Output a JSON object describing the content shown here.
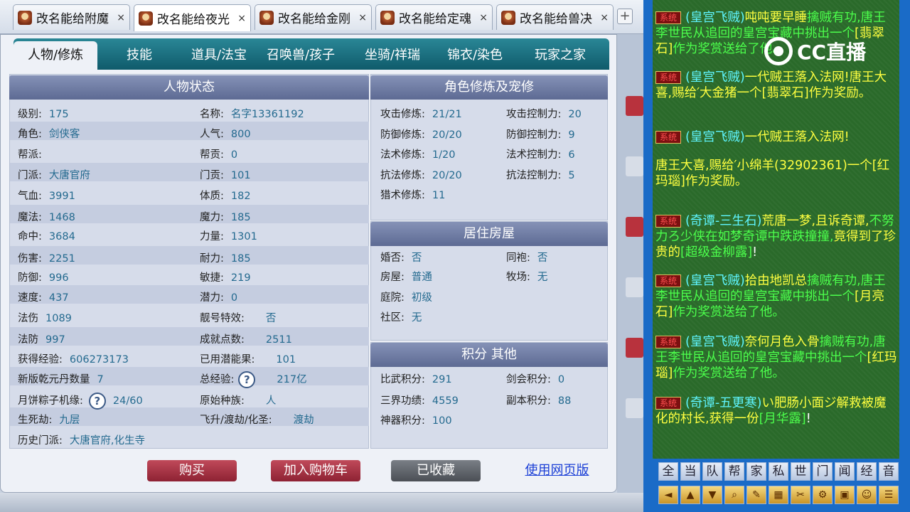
{
  "browser_tabs": [
    {
      "label": "改名能给附魔",
      "close": "×"
    },
    {
      "label": "改名能给夜光",
      "close": "×"
    },
    {
      "label": "改名能给金刚",
      "close": "×"
    },
    {
      "label": "改名能给定魂",
      "close": "×"
    },
    {
      "label": "改名能给兽决",
      "close": "×"
    }
  ],
  "new_tab": "+",
  "nav_tabs": [
    "人物/修炼",
    "技能",
    "道具/法宝",
    "召唤兽/孩子",
    "坐骑/祥瑞",
    "锦衣/染色",
    "玩家之家"
  ],
  "status": {
    "title": "人物状态",
    "left": [
      {
        "l": "级别:",
        "v": "175"
      },
      {
        "l": "角色:",
        "v": "剑侠客"
      },
      {
        "l": "帮派:",
        "v": ""
      },
      {
        "l": "门派:",
        "v": "大唐官府"
      },
      {
        "l": "气血:",
        "v": "3991"
      },
      {
        "l": "魔法:",
        "v": "1468"
      },
      {
        "l": "命中:",
        "v": "3684"
      },
      {
        "l": "伤害:",
        "v": "2251"
      },
      {
        "l": "防御:",
        "v": "996"
      },
      {
        "l": "速度:",
        "v": "437"
      },
      {
        "l": "法伤",
        "v": "1089"
      },
      {
        "l": "法防",
        "v": "997"
      },
      {
        "l": "获得经验:",
        "v": "606273173"
      },
      {
        "l": "新版乾元丹数量",
        "v": "7"
      },
      {
        "l": "月饼粽子机缘:",
        "v": "24/60"
      },
      {
        "l": "生死劫:",
        "v": "九层"
      },
      {
        "l": "历史门派:",
        "v": "大唐官府,化生寺"
      }
    ],
    "right": [
      {
        "l": "名称:",
        "v": "名字13361192"
      },
      {
        "l": "人气:",
        "v": "800"
      },
      {
        "l": "帮贡:",
        "v": "0"
      },
      {
        "l": "门贡:",
        "v": "101"
      },
      {
        "l": "体质:",
        "v": "182"
      },
      {
        "l": "魔力:",
        "v": "185"
      },
      {
        "l": "力量:",
        "v": "1301"
      },
      {
        "l": "耐力:",
        "v": "185"
      },
      {
        "l": "敏捷:",
        "v": "219"
      },
      {
        "l": "潜力:",
        "v": "0"
      },
      {
        "l": "靓号特效:",
        "v": "否"
      },
      {
        "l": "成就点数:",
        "v": "2511"
      },
      {
        "l": "已用潜能果:",
        "v": "101"
      },
      {
        "l": "总经验:",
        "v": "217亿"
      },
      {
        "l": "原始种族:",
        "v": "人"
      },
      {
        "l": "飞升/渡劫/化圣:",
        "v": "渡劫"
      }
    ],
    "help": "?"
  },
  "cultivation": {
    "title": "角色修炼及宠修",
    "left": [
      {
        "l": "攻击修炼:",
        "v": "21/21"
      },
      {
        "l": "防御修炼:",
        "v": "20/20"
      },
      {
        "l": "法术修炼:",
        "v": "1/20"
      },
      {
        "l": "抗法修炼:",
        "v": "20/20"
      },
      {
        "l": "猎术修炼:",
        "v": "11"
      }
    ],
    "right": [
      {
        "l": "攻击控制力:",
        "v": "20"
      },
      {
        "l": "防御控制力:",
        "v": "9"
      },
      {
        "l": "法术控制力:",
        "v": "6"
      },
      {
        "l": "抗法控制力:",
        "v": "5"
      }
    ]
  },
  "housing": {
    "title": "居住房屋",
    "left": [
      {
        "l": "婚否:",
        "v": "否"
      },
      {
        "l": "房屋:",
        "v": "普通"
      },
      {
        "l": "庭院:",
        "v": "初级"
      },
      {
        "l": "社区:",
        "v": "无"
      }
    ],
    "right": [
      {
        "l": "同袍:",
        "v": "否"
      },
      {
        "l": "牧场:",
        "v": "无"
      }
    ]
  },
  "points": {
    "title": "积分 其他",
    "left": [
      {
        "l": "比武积分:",
        "v": "291"
      },
      {
        "l": "三界功绩:",
        "v": "4559"
      },
      {
        "l": "神器积分:",
        "v": "100"
      }
    ],
    "right": [
      {
        "l": "剑会积分:",
        "v": "0"
      },
      {
        "l": "副本积分:",
        "v": "88"
      }
    ]
  },
  "actions": {
    "buy": "购买",
    "add_cart": "加入购物车",
    "favorited": "已收藏",
    "web": "使用网页版"
  },
  "chat": {
    "tag": "系统",
    "messages": [
      [
        [
          "cy",
          "(皇宫飞贼)"
        ],
        [
          "yl",
          "吨吨要早睡"
        ],
        [
          "gr",
          "擒贼有功,唐王李世民从追回的皇宫宝藏中挑出一个"
        ],
        [
          "yl",
          "[翡翠石]"
        ],
        [
          "gr",
          "作为奖赏送给了他。"
        ]
      ],
      [
        [
          "cy",
          "(皇宫飞贼)"
        ],
        [
          "yl",
          "一代贼王落入法网!唐王大喜,赐给′大金猪一个"
        ],
        [
          "yl",
          "[翡翠石]"
        ],
        [
          "yl",
          "作为奖励。"
        ]
      ],
      [
        [
          "cy",
          "(皇宫飞贼)"
        ],
        [
          "yl",
          "一代贼王落入法网!"
        ]
      ],
      [
        [
          "yl",
          "唐王大喜,赐给′小绵羊(32902"
        ],
        [
          "yl",
          "361)一个"
        ],
        [
          "yl",
          "[红玛瑙]"
        ],
        [
          "yl",
          "作为奖励。"
        ]
      ],
      [
        [
          "cy",
          "(奇谭-三生石)"
        ],
        [
          "yl",
          "荒唐一梦,且诉奇谭,"
        ],
        [
          "gr",
          "不努力ろ少侠在如梦奇谭中跌跌撞撞,"
        ],
        [
          "yl",
          "竟得到了珍贵的"
        ],
        [
          "gr",
          "[超级金柳露]"
        ],
        [
          "wh",
          "!"
        ]
      ],
      [
        [
          "cy",
          "(皇宫飞贼)"
        ],
        [
          "yl",
          "拾由地凯总"
        ],
        [
          "gr",
          "擒贼有功,唐王李世民从追回的皇宫宝藏中挑出一个"
        ],
        [
          "yl",
          "[月亮石]"
        ],
        [
          "gr",
          "作为奖赏送给了他。"
        ]
      ],
      [
        [
          "cy",
          "(皇宫飞贼)"
        ],
        [
          "yl",
          "奈何月色入骨"
        ],
        [
          "gr",
          "擒贼有功,唐王李世民从追回的皇宫宝藏中挑出一个"
        ],
        [
          "yl",
          "[红玛瑙]"
        ],
        [
          "gr",
          "作为奖赏送给了他。"
        ]
      ],
      [
        [
          "cy",
          "(奇谭-五更寒)"
        ],
        [
          "yl",
          "い肥肠小面ジ解救被魔化的村长,获得一份"
        ],
        [
          "gr",
          "[月华露]"
        ],
        [
          "wh",
          "!"
        ]
      ]
    ],
    "channels": [
      "全",
      "当",
      "队",
      "帮",
      "家",
      "私",
      "世",
      "门",
      "闻",
      "经",
      "音"
    ],
    "tools": [
      "◄",
      "▲",
      "▼",
      "⌕",
      "✎",
      "▦",
      "✂",
      "⚙",
      "▣",
      "☺",
      "☰"
    ]
  },
  "watermark": "CC直播"
}
